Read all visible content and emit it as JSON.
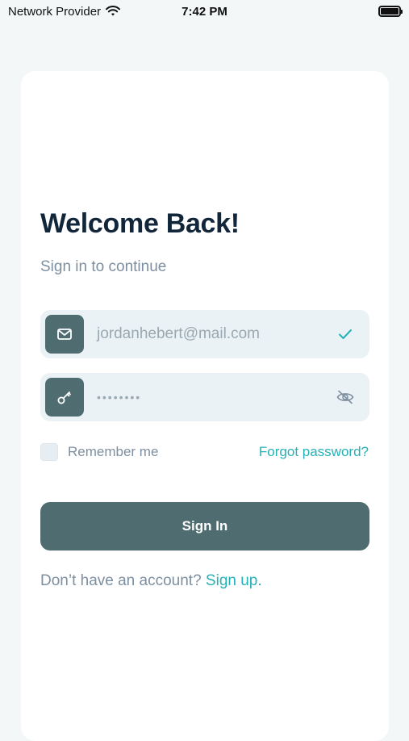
{
  "status_bar": {
    "carrier": "Network Provider",
    "time": "7:42 PM",
    "icons": [
      "wifi-icon",
      "battery-icon"
    ]
  },
  "login": {
    "title": "Welcome Back!",
    "subtitle": "Sign in to continue",
    "email": {
      "value": "jordanhebert@mail.com",
      "icon": "mail-icon",
      "trailing_icon": "check-icon"
    },
    "password": {
      "value": "••••••••",
      "icon": "key-icon",
      "trailing_icon": "eye-off-icon"
    },
    "remember_label": "Remember me",
    "forgot_label": "Forgot password?",
    "sign_in_label": "Sign In",
    "signup_prompt": "Don’t have an account?",
    "signup_link": "Sign up."
  },
  "colors": {
    "accent": "#26b1b7",
    "primary": "#4f6d70",
    "title": "#12263a",
    "muted": "#7d8fa0",
    "field_bg": "#eaf2f6"
  }
}
